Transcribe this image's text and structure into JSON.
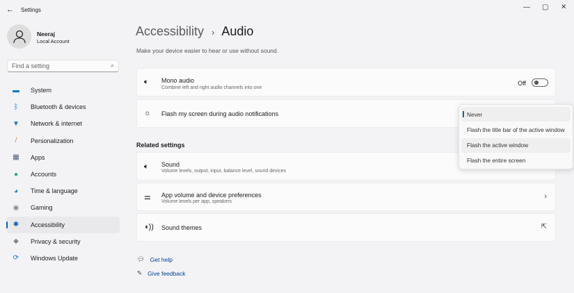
{
  "window": {
    "title": "Settings",
    "back_icon": "←",
    "minimize": "—",
    "maximize": "▢",
    "close": "✕"
  },
  "user": {
    "name": "Neeraj",
    "account": "Local Account"
  },
  "search": {
    "placeholder": "Find a setting"
  },
  "nav": [
    {
      "label": "System",
      "icon": "▬",
      "color": "#0078d4"
    },
    {
      "label": "Bluetooth & devices",
      "icon": "ᛒ",
      "color": "#0067c0"
    },
    {
      "label": "Network & internet",
      "icon": "▼",
      "color": "#1a73c8"
    },
    {
      "label": "Personalization",
      "icon": "/",
      "color": "#c88a3a"
    },
    {
      "label": "Apps",
      "icon": "▦",
      "color": "#4a5a78"
    },
    {
      "label": "Accounts",
      "icon": "●",
      "color": "#2aa57a"
    },
    {
      "label": "Time & language",
      "icon": "◕",
      "color": "#1a80d0"
    },
    {
      "label": "Gaming",
      "icon": "◉",
      "color": "#888"
    },
    {
      "label": "Accessibility",
      "icon": "✱",
      "color": "#0a5fb8"
    },
    {
      "label": "Privacy & security",
      "icon": "◆",
      "color": "#888"
    },
    {
      "label": "Windows Update",
      "icon": "⟳",
      "color": "#1a73c8"
    }
  ],
  "header": {
    "crumb": "Accessibility",
    "sep": "›",
    "title": "Audio",
    "subtitle": "Make your device easier to hear or use without sound."
  },
  "mono": {
    "title": "Mono audio",
    "desc": "Combine left and right audio channels into one",
    "state": "Off"
  },
  "flash": {
    "title": "Flash my screen during audio notifications",
    "options": [
      "Never",
      "Flash the title bar of the active window",
      "Flash the active window",
      "Flash the entire screen"
    ],
    "selected": "Never"
  },
  "related": {
    "heading": "Related settings",
    "sound": {
      "title": "Sound",
      "desc": "Volume levels, output, input, balance level, sound devices"
    },
    "appvol": {
      "title": "App volume and device preferences",
      "desc": "Volume levels per app, speakers"
    },
    "themes": {
      "title": "Sound themes"
    }
  },
  "links": {
    "help": "Get help",
    "feedback": "Give feedback"
  }
}
